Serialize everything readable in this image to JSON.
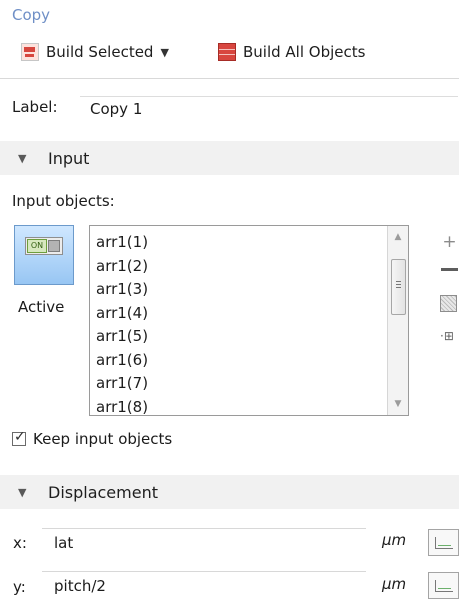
{
  "window": {
    "title": "Copy"
  },
  "toolbar": {
    "build_selected_label": "Build Selected",
    "build_all_label": "Build All Objects"
  },
  "label_row": {
    "label": "Label:",
    "value": "Copy 1"
  },
  "sections": {
    "input": "Input",
    "displacement": "Displacement"
  },
  "input": {
    "objects_label": "Input objects:",
    "active_on_text": "ON",
    "active_label": "Active",
    "objects": [
      "arr1(1)",
      "arr1(2)",
      "arr1(3)",
      "arr1(4)",
      "arr1(5)",
      "arr1(6)",
      "arr1(7)",
      "arr1(8)"
    ],
    "keep_input_objects": {
      "checked": true,
      "label": "Keep input objects"
    }
  },
  "displacement": {
    "x": {
      "label": "x:",
      "value": "lat",
      "unit": "µm"
    },
    "y": {
      "label": "y:",
      "value": "pitch/2",
      "unit": "µm"
    }
  },
  "icons": {
    "build_selected": "build-selected-icon",
    "build_all": "build-all-objects-icon",
    "dropdown": "chevron-down-icon",
    "section_collapse": "collapse-triangle-icon",
    "active_toggle": "toggle-on-icon",
    "add": "plus-icon",
    "remove": "minus-icon",
    "clear": "clear-selection-icon",
    "expression": "expression-builder-icon"
  }
}
